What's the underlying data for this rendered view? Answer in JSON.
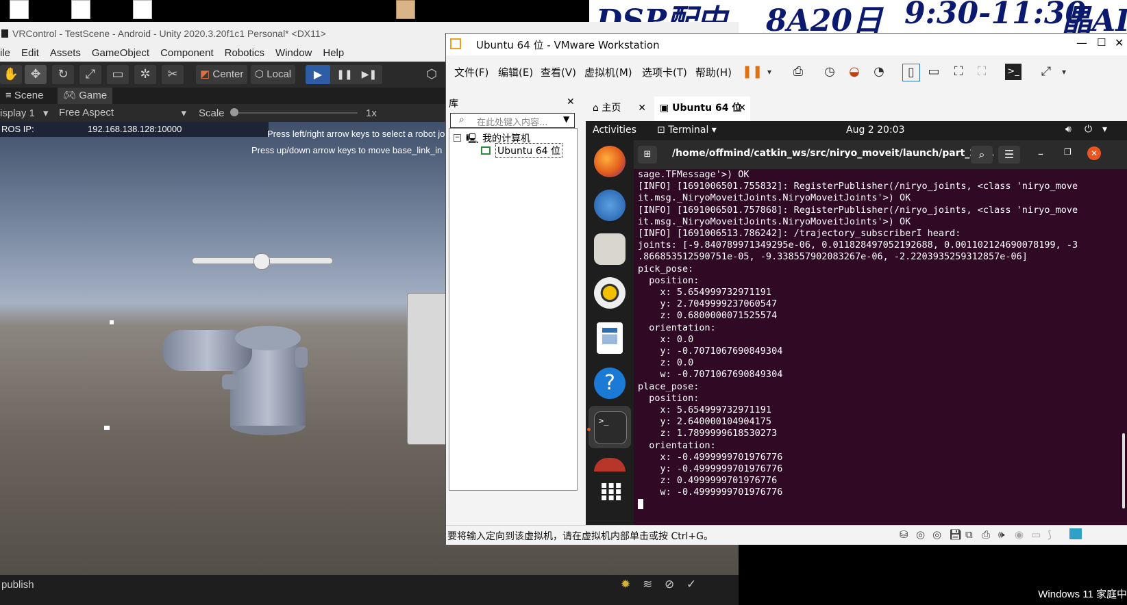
{
  "banner": {
    "text1": "DSP配中",
    "text2": "8A20日",
    "text3": "9:30-11:30",
    "text4": "晶AI"
  },
  "windows_label": "Windows 11 家庭中",
  "unity": {
    "title": "VRControl - TestScene - Android - Unity 2020.3.20f1c1 Personal* <DX11>",
    "menu": [
      "ile",
      "Edit",
      "Assets",
      "GameObject",
      "Component",
      "Robotics",
      "Window",
      "Help"
    ],
    "toolbar": {
      "center_label": "Center",
      "local_label": "Local"
    },
    "tabs": {
      "scene": "Scene",
      "game": "Game"
    },
    "gamebar": {
      "display": "isplay 1",
      "aspect": "Free Aspect",
      "scale_label": "Scale",
      "scale_value": "1x"
    },
    "ros_label": "ROS IP:",
    "ros_value": "192.168.138.128:10000",
    "hint1": "Press left/right arrow keys to select a robot jo",
    "hint2": "Press up/down arrow keys to move base_link_in",
    "status_text": "publish"
  },
  "vmware": {
    "title": "Ubuntu 64 位 - VMware Workstation",
    "menu": [
      "文件(F)",
      "编辑(E)",
      "查看(V)",
      "虚拟机(M)",
      "选项卡(T)",
      "帮助(H)"
    ],
    "library": {
      "title": "库",
      "search_placeholder": "在此处键入内容...",
      "tree_root": "我的计算机",
      "tree_child": "Ubuntu 64 位"
    },
    "tabs": {
      "home": "主页",
      "vm": "Ubuntu 64 位"
    },
    "status_text": "要将输入定向到该虚拟机，请在虚拟机内部单击或按 Ctrl+G。"
  },
  "ubuntu": {
    "activities": "Activities",
    "app": "Terminal",
    "clock": "Aug 2  20:03",
    "terminal_title": "/home/offmind/catkin_ws/src/niryo_moveit/launch/part_2.l...",
    "lines": [
      "sage.TFMessage'>) OK",
      "[INFO] [1691006501.755832]: RegisterPublisher(/niryo_joints, <class 'niryo_move",
      "it.msg._NiryoMoveitJoints.NiryoMoveitJoints'>) OK",
      "[INFO] [1691006501.757868]: RegisterPublisher(/niryo_joints, <class 'niryo_move",
      "it.msg._NiryoMoveitJoints.NiryoMoveitJoints'>) OK",
      "[INFO] [1691006513.786242]: /trajectory_subscriberI heard:",
      "joints: [-9.840789971349295e-06, 0.011828497052192688, 0.001102124690078199, -3",
      ".866853512590751e-05, -9.338557902083267e-06, -2.2203935259312857e-06]",
      "pick_pose:",
      "  position:",
      "    x: 5.654999732971191",
      "    y: 2.7049999237060547",
      "    z: 0.6800000071525574",
      "  orientation:",
      "    x: 0.0",
      "    y: -0.7071067690849304",
      "    z: 0.0",
      "    w: -0.7071067690849304",
      "place_pose:",
      "  position:",
      "    x: 5.654999732971191",
      "    y: 2.640000104904175",
      "    z: 1.7899999618530273",
      "  orientation:",
      "    x: -0.4999999701976776",
      "    y: -0.4999999701976776",
      "    z: 0.4999999701976776",
      "    w: -0.4999999701976776"
    ]
  }
}
